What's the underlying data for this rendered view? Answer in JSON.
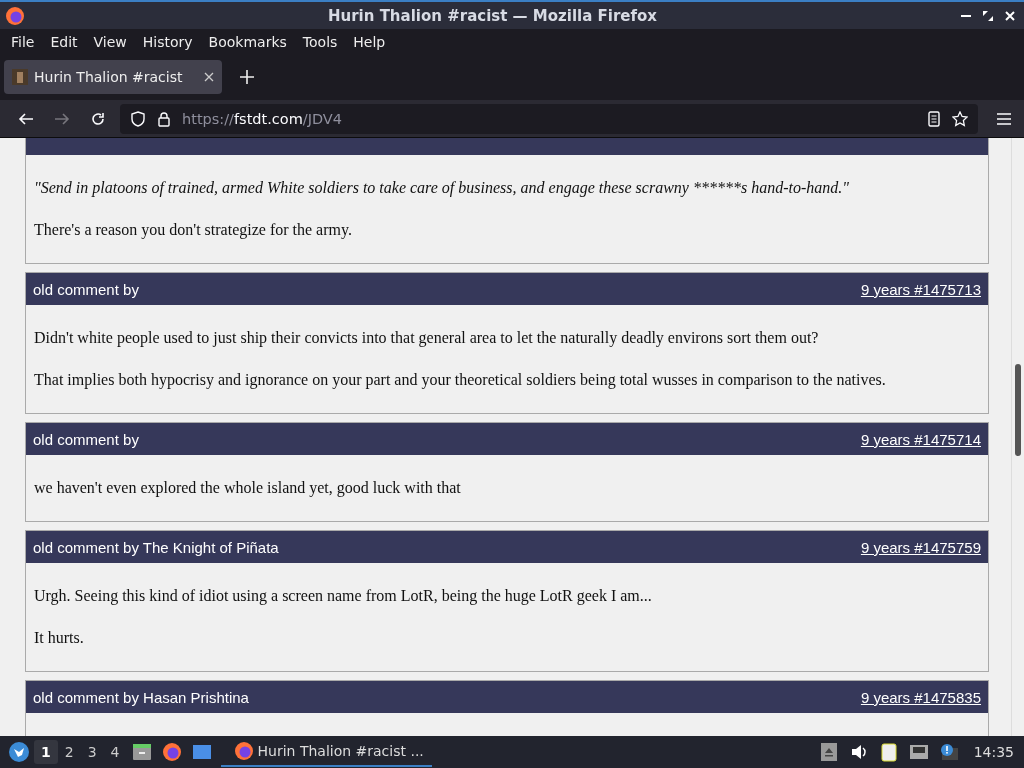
{
  "window": {
    "title": "Hurin Thalion #racist — Mozilla Firefox"
  },
  "menu": [
    "File",
    "Edit",
    "View",
    "History",
    "Bookmarks",
    "Tools",
    "Help"
  ],
  "tabs": [
    {
      "label": "Hurin Thalion #racist",
      "selected": true
    }
  ],
  "url": {
    "scheme": "https://",
    "host": "fstdt.com",
    "path": "/JDV4"
  },
  "comments": [
    {
      "paragraphs": [
        {
          "kind": "quote",
          "text": "\"Send in platoons of trained, armed White soldiers to take care of business, and engage these scrawny ******s hand-to-hand.\""
        },
        {
          "kind": "plain",
          "text": "There's a reason you don't strategize for the army."
        }
      ]
    },
    {
      "author": "old comment by",
      "link": "9 years #1475713",
      "paragraphs": [
        {
          "kind": "plain",
          "text": "Didn't white people used to just ship their convicts into that general area to let the naturally deadly environs sort them out?"
        },
        {
          "kind": "plain",
          "text": "That implies both hypocrisy and ignorance on your part and your theoretical soldiers being total wusses in comparison to the natives."
        }
      ]
    },
    {
      "author": "old comment by",
      "link": "9 years #1475714",
      "paragraphs": [
        {
          "kind": "plain",
          "text": "we haven't even explored the whole island yet, good luck with that"
        }
      ]
    },
    {
      "author": "old comment by The Knight of Piñata",
      "link": "9 years #1475759",
      "paragraphs": [
        {
          "kind": "plain",
          "text": "Urgh. Seeing this kind of idiot using a screen name from LotR, being the huge LotR geek I am..."
        },
        {
          "kind": "plain",
          "text": "It hurts."
        }
      ]
    },
    {
      "author": "old comment by Hasan Prishtina",
      "link": "9 years #1475835"
    }
  ],
  "taskbar": {
    "workspaces": [
      {
        "label": "1",
        "selected": true
      },
      {
        "label": "2",
        "selected": false
      },
      {
        "label": "3",
        "selected": false
      },
      {
        "label": "4",
        "selected": false
      }
    ],
    "window": "Hurin Thalion #racist ...",
    "clock": "14:35"
  }
}
